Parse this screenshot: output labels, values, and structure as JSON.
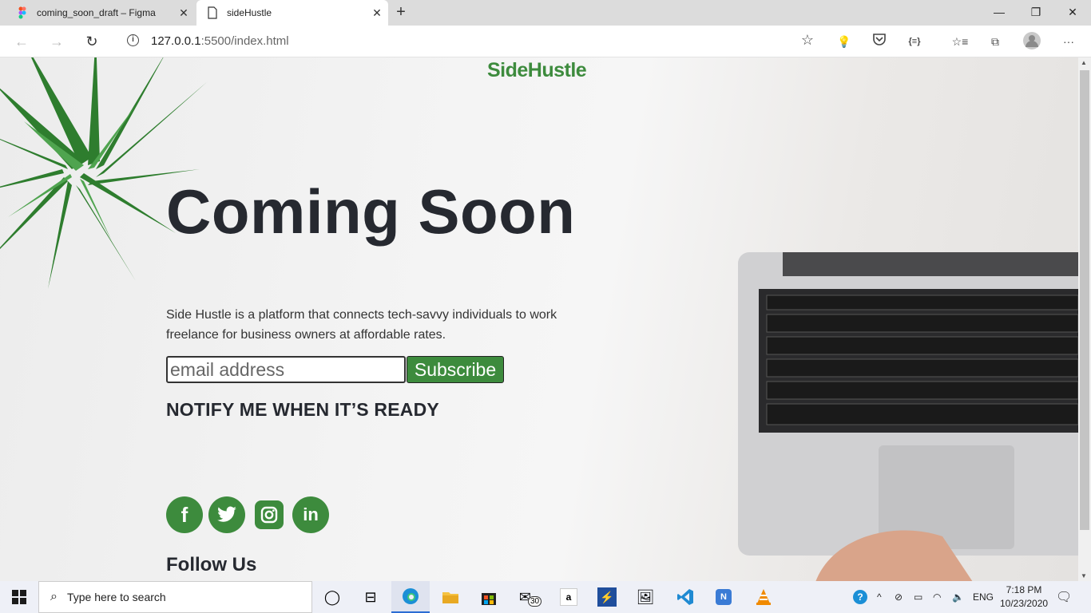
{
  "browser": {
    "tabs": [
      {
        "title": "coming_soon_draft – Figma",
        "active": false
      },
      {
        "title": "sideHustle",
        "active": true
      }
    ],
    "url_host": "127.0.0.1",
    "url_rest": ":5500/index.html"
  },
  "page": {
    "logo": "SideHustle",
    "heading": "Coming Soon",
    "description": "Side Hustle is a platform that connects tech-savvy individuals to work freelance for business owners at affordable rates.",
    "email_placeholder": "email address",
    "subscribe_label": "Subscribe",
    "notify_text": "NOTIFY ME WHEN IT’S READY",
    "social": [
      {
        "icon": "facebook-icon",
        "glyph": "f"
      },
      {
        "icon": "twitter-icon",
        "glyph": "t"
      },
      {
        "icon": "instagram-icon",
        "glyph": "◎"
      },
      {
        "icon": "linkedin-icon",
        "glyph": "in"
      }
    ],
    "follow_label": "Follow Us",
    "brand_color": "#3d8b3d"
  },
  "taskbar": {
    "search_placeholder": "Type here to search",
    "mail_badge": "30",
    "language": "ENG",
    "time": "7:18 PM",
    "date": "10/23/2020"
  }
}
